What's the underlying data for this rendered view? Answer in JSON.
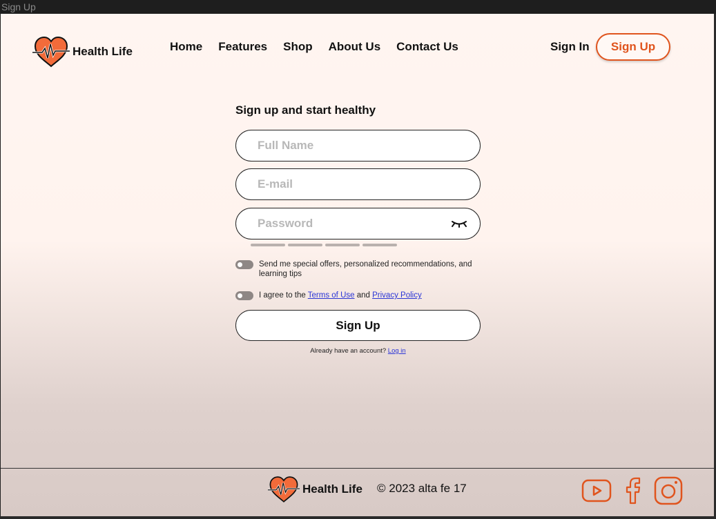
{
  "window": {
    "title": "Sign Up"
  },
  "brand": {
    "name": "Health Life",
    "accent": "#e0541d"
  },
  "nav": {
    "items": [
      {
        "label": "Home"
      },
      {
        "label": "Features"
      },
      {
        "label": "Shop"
      },
      {
        "label": "About Us"
      },
      {
        "label": "Contact Us"
      }
    ],
    "sign_in": "Sign In",
    "sign_up": "Sign Up"
  },
  "form": {
    "title": "Sign up and start healthy",
    "full_name": {
      "placeholder": "Full Name",
      "value": ""
    },
    "email": {
      "placeholder": "E-mail",
      "value": ""
    },
    "password": {
      "placeholder": "Password",
      "value": ""
    },
    "offers_toggle": {
      "label": "Send me special offers, personalized recommendations, and learning tips",
      "on": false
    },
    "terms_toggle": {
      "prefix": "I agree to the",
      "terms_link": "Terms of Use",
      "and": "and",
      "privacy_link": "Privacy Policy",
      "on": false
    },
    "submit": "Sign Up",
    "already_text": "Already have an account?",
    "login_link": "Log in"
  },
  "footer": {
    "brand": "Health Life",
    "copyright": "© 2023 alta fe 17",
    "socials": [
      "youtube-icon",
      "facebook-icon",
      "instagram-icon"
    ]
  }
}
